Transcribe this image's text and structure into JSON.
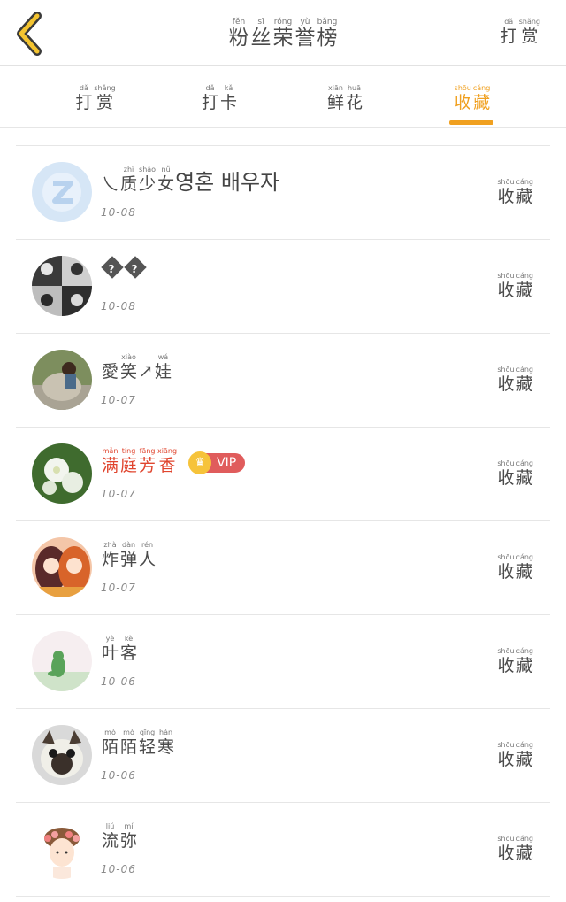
{
  "header": {
    "title": [
      {
        "pin": "fěn",
        "han": "粉"
      },
      {
        "pin": "sī",
        "han": "丝"
      },
      {
        "pin": "róng",
        "han": "荣"
      },
      {
        "pin": "yù",
        "han": "誉"
      },
      {
        "pin": "bǎng",
        "han": "榜"
      }
    ],
    "right": [
      {
        "pin": "dǎ",
        "han": "打"
      },
      {
        "pin": "shǎng",
        "han": "赏"
      }
    ]
  },
  "tabs": [
    {
      "name": "tab-reward",
      "chars": [
        {
          "pin": "dǎ",
          "han": "打"
        },
        {
          "pin": "shǎng",
          "han": "赏"
        }
      ],
      "active": false
    },
    {
      "name": "tab-checkin",
      "chars": [
        {
          "pin": "dǎ",
          "han": "打"
        },
        {
          "pin": "kǎ",
          "han": "卡"
        }
      ],
      "active": false
    },
    {
      "name": "tab-flowers",
      "chars": [
        {
          "pin": "xiān",
          "han": "鲜"
        },
        {
          "pin": "huā",
          "han": "花"
        }
      ],
      "active": false
    },
    {
      "name": "tab-collect",
      "chars": [
        {
          "pin": "shōu",
          "han": "收"
        },
        {
          "pin": "cáng",
          "han": "藏"
        }
      ],
      "active": true
    }
  ],
  "fav_label": [
    {
      "pin": "shōu",
      "han": "收"
    },
    {
      "pin": "cáng",
      "han": "藏"
    }
  ],
  "users": [
    {
      "chars": [
        {
          "pin": "",
          "han": "乀"
        },
        {
          "pin": "zhì",
          "han": "质"
        },
        {
          "pin": "shǎo",
          "han": "少"
        },
        {
          "pin": "nǚ",
          "han": "女"
        }
      ],
      "plain": "영혼 배우자",
      "date": "10-08",
      "avatar": "qq-default-avatar",
      "vip": false,
      "red": false
    },
    {
      "chars": [],
      "plain": "",
      "qmarks": 2,
      "date": "10-08",
      "avatar": "group-photo-avatar",
      "vip": false,
      "red": false
    },
    {
      "chars": [
        {
          "pin": "",
          "han": "愛"
        },
        {
          "pin": "xiào",
          "han": "笑"
        },
        {
          "pin": "",
          "han": "↗"
        },
        {
          "pin": "wá",
          "han": "娃"
        }
      ],
      "plain": "",
      "date": "10-07",
      "avatar": "girl-statue-avatar",
      "vip": false,
      "red": false
    },
    {
      "chars": [
        {
          "pin": "mǎn",
          "han": "满"
        },
        {
          "pin": "tíng",
          "han": "庭"
        },
        {
          "pin": "fāng",
          "han": "芳"
        },
        {
          "pin": "xiāng",
          "han": "香"
        }
      ],
      "plain": "",
      "date": "10-07",
      "avatar": "white-flower-avatar",
      "vip": true,
      "vip_label": "VIP",
      "red": true
    },
    {
      "chars": [
        {
          "pin": "zhà",
          "han": "炸"
        },
        {
          "pin": "dàn",
          "han": "弹"
        },
        {
          "pin": "rén",
          "han": "人"
        }
      ],
      "plain": "",
      "date": "10-07",
      "avatar": "anime-girls-avatar",
      "vip": false,
      "red": false
    },
    {
      "chars": [
        {
          "pin": "yè",
          "han": "叶"
        },
        {
          "pin": "kè",
          "han": "客"
        }
      ],
      "plain": "",
      "date": "10-06",
      "avatar": "dinosaur-avatar",
      "vip": false,
      "red": false
    },
    {
      "chars": [
        {
          "pin": "mò",
          "han": "陌"
        },
        {
          "pin": "mò",
          "han": "陌"
        },
        {
          "pin": "qīng",
          "han": "轻"
        },
        {
          "pin": "hán",
          "han": "寒"
        }
      ],
      "plain": "",
      "date": "10-06",
      "avatar": "siamese-cat-avatar",
      "vip": false,
      "red": false
    },
    {
      "chars": [
        {
          "pin": "liú",
          "han": "流"
        },
        {
          "pin": "mí",
          "han": "弥"
        }
      ],
      "plain": "",
      "date": "10-06",
      "avatar": "cartoon-girl-avatar",
      "vip": false,
      "red": false
    }
  ]
}
